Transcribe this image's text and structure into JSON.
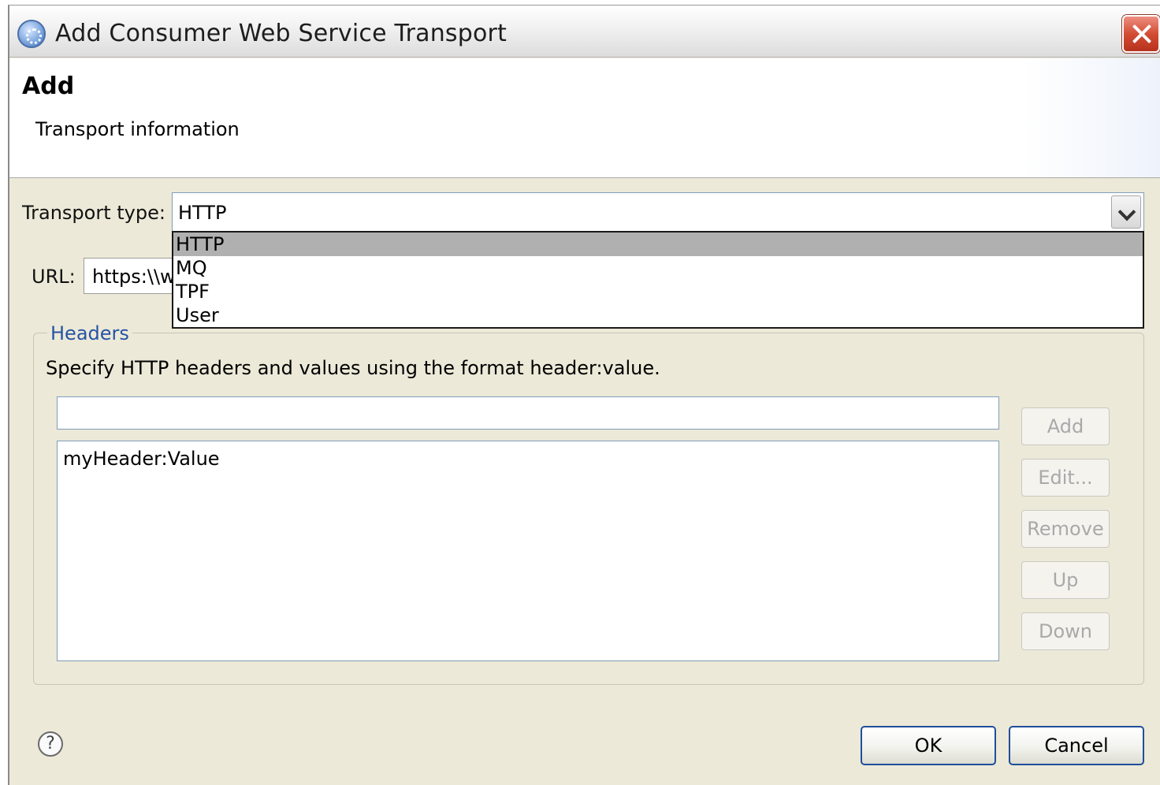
{
  "window": {
    "title": "Add Consumer Web Service Transport",
    "icon": "service-gear-icon",
    "close_icon": "close-x-icon"
  },
  "banner": {
    "title": "Add",
    "subtitle": "Transport information"
  },
  "transport": {
    "label": "Transport type:",
    "selected": "HTTP",
    "options": [
      "HTTP",
      "MQ",
      "TPF",
      "User"
    ],
    "highlighted_option": "HTTP"
  },
  "url": {
    "label": "URL:",
    "value": "https:\\\\w"
  },
  "headers": {
    "legend": "Headers",
    "description": "Specify HTTP headers and values using the format header:value.",
    "input_value": "",
    "items": [
      "myHeader:Value"
    ],
    "buttons": {
      "add": "Add",
      "edit": "Edit...",
      "remove": "Remove",
      "up": "Up",
      "down": "Down"
    }
  },
  "footer": {
    "help_icon": "help-icon",
    "help_glyph": "?",
    "ok": "OK",
    "cancel": "Cancel"
  },
  "colors": {
    "dialog_bg": "#ece9d8",
    "legend_blue": "#2653a4",
    "close_red": "#d34c34",
    "button_border": "#1f4f9a",
    "selection_gray": "#b0b0b0"
  }
}
